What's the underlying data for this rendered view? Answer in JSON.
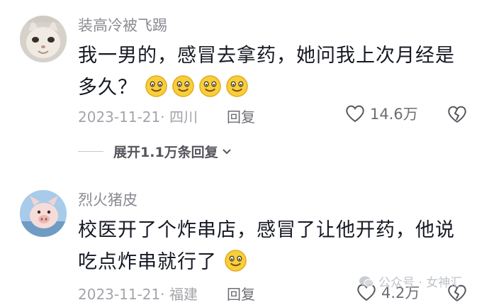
{
  "comments": [
    {
      "username": "装高冷被飞踢",
      "text": "我一男的，感冒去拿药，她问我上次月经是多久？",
      "emoji_count": 4,
      "date_location": "2023-11-21· 四川",
      "reply_label": "回复",
      "likes": "14.6万",
      "expand_label": "展开1.1万条回复",
      "avatar_icon": "cat-avatar"
    },
    {
      "username": "烈火猪皮",
      "text": "校医开了个炸串店，感冒了让他开药，他说吃点炸串就行了",
      "emoji_count": 1,
      "date_location": "2023-11-21· 福建",
      "reply_label": "回复",
      "likes": "4.2万",
      "avatar_icon": "pig-avatar"
    }
  ],
  "watermark": "公众号 · 女神汇",
  "icons": {
    "like": "heart-outline-icon",
    "dislike": "broken-heart-icon",
    "emoji": "smile-emoji-icon",
    "expand": "chevron-down-icon",
    "watermark": "wechat-icon"
  },
  "colors": {
    "text": "#161823",
    "meta": "#a3a4a9",
    "username": "#8a8b91",
    "emoji_fill": "#f8cf3a"
  }
}
